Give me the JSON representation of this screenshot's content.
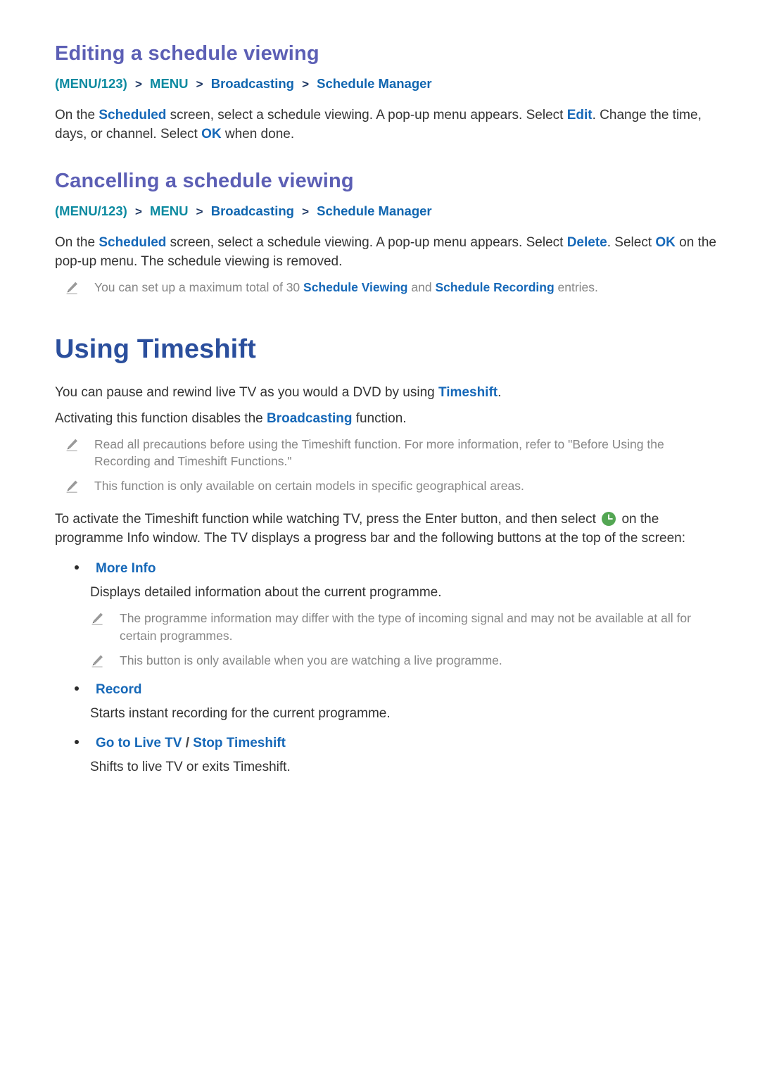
{
  "colors": {
    "section_heading": "#5c5fb5",
    "chapter_heading": "#2b4f9d",
    "link_blue": "#1668b8",
    "breadcrumb_menu_teal": "#0c8aa0",
    "breadcrumb_link": "#1166b0",
    "note_gray": "#868686",
    "body": "#333333",
    "clock_badge_green": "#53a653"
  },
  "sections": {
    "editing": {
      "heading": "Editing a schedule viewing",
      "breadcrumb": {
        "menu123": "(MENU/123)",
        "sep": ">",
        "menu": "MENU",
        "broadcasting": "Broadcasting",
        "schedule_manager": "Schedule Manager"
      },
      "paragraph": {
        "p1": "On the ",
        "link1": "Scheduled",
        "p2": " screen, select a schedule viewing. A pop-up menu appears. Select ",
        "link2": "Edit",
        "p3": ". Change the time, days, or channel. Select ",
        "link3": "OK",
        "p4": " when done."
      }
    },
    "cancelling": {
      "heading": "Cancelling a schedule viewing",
      "breadcrumb": {
        "menu123": "(MENU/123)",
        "sep": ">",
        "menu": "MENU",
        "broadcasting": "Broadcasting",
        "schedule_manager": "Schedule Manager"
      },
      "paragraph": {
        "p1": "On the ",
        "link1": "Scheduled",
        "p2": " screen, select a schedule viewing. A pop-up menu appears. Select ",
        "link2": "Delete",
        "p3": ". Select ",
        "link3": "OK",
        "p4": " on the pop-up menu. The schedule viewing is removed."
      },
      "note": {
        "t1": "You can set up a maximum total of 30 ",
        "link1": "Schedule Viewing",
        "t2": " and ",
        "link2": "Schedule Recording",
        "t3": " entries."
      }
    },
    "timeshift": {
      "heading": "Using Timeshift",
      "intro1": {
        "p1": "You can pause and rewind live TV as you would a DVD by using ",
        "link1": "Timeshift",
        "p2": "."
      },
      "intro2": {
        "p1": "Activating this function disables the ",
        "link1": "Broadcasting",
        "p2": " function."
      },
      "notes": [
        "Read all precautions before using the Timeshift function. For more information, refer to \"Before Using the Recording and Timeshift Functions.\"",
        "This function is only available on certain models in specific geographical areas."
      ],
      "activation": {
        "p1": "To activate the Timeshift function while watching TV, press the Enter button, and then select ",
        "icon": "clock-badge-icon",
        "p2": " on the programme Info window. The TV displays a progress bar and the following buttons at the top of the screen:"
      },
      "buttons": [
        {
          "label": "More Info",
          "description": "Displays detailed information about the current programme.",
          "notes": [
            "The programme information may differ with the type of incoming signal and may not be available at all for certain programmes.",
            "This button is only available when you are watching a live programme."
          ]
        },
        {
          "label": "Record",
          "description": "Starts instant recording for the current programme.",
          "notes": []
        },
        {
          "label_part1": "Go to Live TV",
          "label_sep": " / ",
          "label_part2": "Stop Timeshift",
          "description": "Shifts to live TV or exits Timeshift.",
          "notes": []
        }
      ]
    }
  }
}
